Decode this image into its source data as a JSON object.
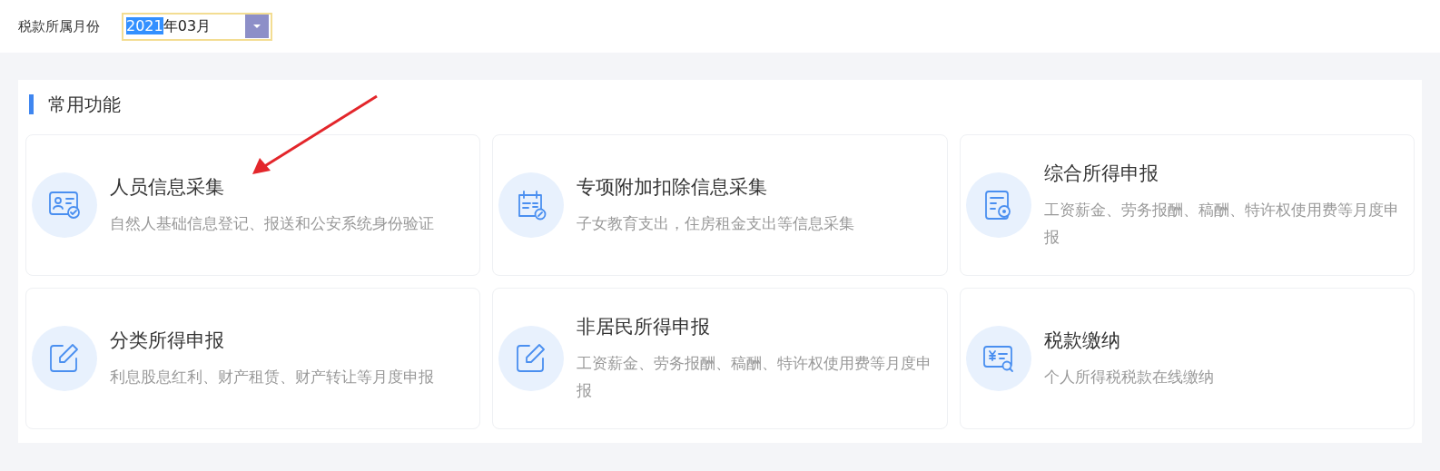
{
  "filter": {
    "label": "税款所属月份",
    "value_parts": [
      {
        "text": "2021",
        "selected": true
      },
      {
        "text": "年03月",
        "selected": false
      }
    ]
  },
  "section": {
    "title": "常用功能",
    "cards": [
      {
        "title": "人员信息采集",
        "description": "自然人基础信息登记、报送和公安系统身份验证"
      },
      {
        "title": "专项附加扣除信息采集",
        "description": "子女教育支出，住房租金支出等信息采集"
      },
      {
        "title": "综合所得申报",
        "description": "工资薪金、劳务报酬、稿酬、特许权使用费等月度申报"
      },
      {
        "title": "分类所得申报",
        "description": "利息股息红利、财产租赁、财产转让等月度申报"
      },
      {
        "title": "非居民所得申报",
        "description": "工资薪金、劳务报酬、稿酬、特许权使用费等月度申报"
      },
      {
        "title": "税款缴纳",
        "description": "个人所得税税款在线缴纳"
      }
    ]
  }
}
